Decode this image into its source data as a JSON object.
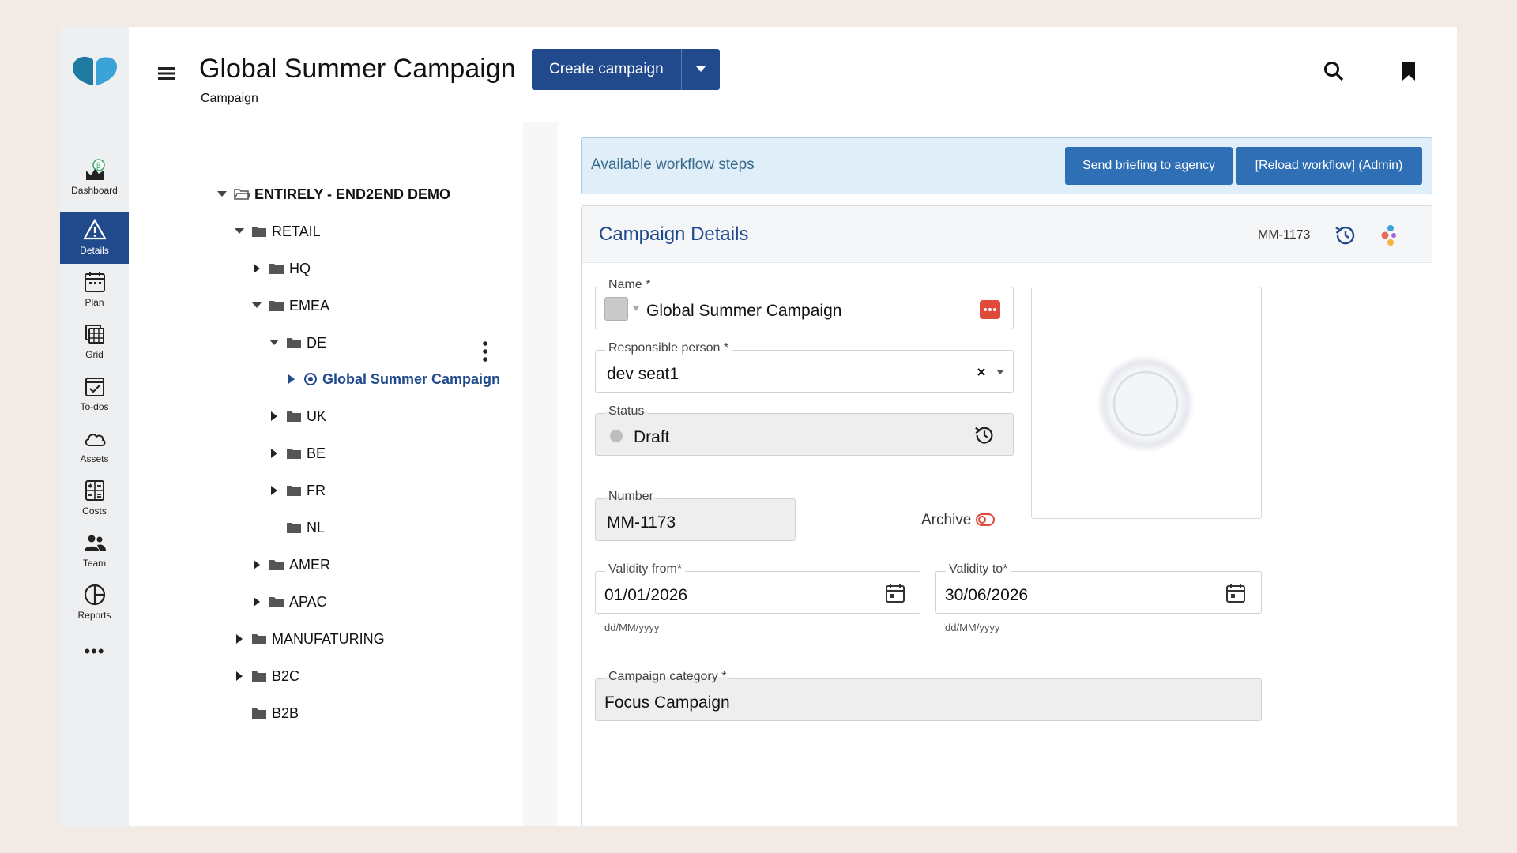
{
  "nav": {
    "items": [
      {
        "label": "Dashboard",
        "icon": "dashboard-icon"
      },
      {
        "label": "Details",
        "icon": "warning-triangle-icon",
        "active": true
      },
      {
        "label": "Plan",
        "icon": "calendar-icon"
      },
      {
        "label": "Grid",
        "icon": "grid-icon"
      },
      {
        "label": "To-dos",
        "icon": "checklist-icon"
      },
      {
        "label": "Assets",
        "icon": "cloud-icon"
      },
      {
        "label": "Costs",
        "icon": "calculator-icon"
      },
      {
        "label": "Team",
        "icon": "team-icon"
      },
      {
        "label": "Reports",
        "icon": "reports-icon"
      }
    ],
    "more": "•••",
    "beta_badge": "β"
  },
  "header": {
    "title": "Global Summer Campaign",
    "subtitle": "Campaign",
    "create_button": "Create campaign"
  },
  "tree": {
    "root": "ENTIRELY - END2END DEMO",
    "nodes": {
      "retail": "RETAIL",
      "hq": "HQ",
      "emea": "EMEA",
      "de": "DE",
      "campaign": "Global Summer Campaign",
      "uk": "UK",
      "be": "BE",
      "fr": "FR",
      "nl": "NL",
      "amer": "AMER",
      "apac": "APAC",
      "manufacturing": "MANUFATURING",
      "b2c": "B2C",
      "b2b": "B2B"
    }
  },
  "workflow": {
    "label": "Available workflow steps",
    "send_briefing": "Send briefing to agency",
    "reload": "[Reload workflow] (Admin)"
  },
  "details": {
    "title": "Campaign Details",
    "number_badge": "MM-1173",
    "name_label": "Name *",
    "name_value": "Global Summer Campaign",
    "responsible_label": "Responsible person *",
    "responsible_value": "dev seat1",
    "status_label": "Status",
    "status_value": "Draft",
    "number_label": "Number",
    "number_value": "MM-1173",
    "archive_label": "Archive",
    "validity_from_label": "Validity from*",
    "validity_from_value": "01/01/2026",
    "validity_to_label": "Validity to*",
    "validity_to_value": "30/06/2026",
    "date_format": "dd/MM/yyyy",
    "category_label": "Campaign category *",
    "category_value": "Focus Campaign"
  },
  "colors": {
    "primary": "#214a8c",
    "workflow_bg": "#dfeef8",
    "workflow_button": "#2f6fb5",
    "alert_red": "#e04a3a"
  }
}
